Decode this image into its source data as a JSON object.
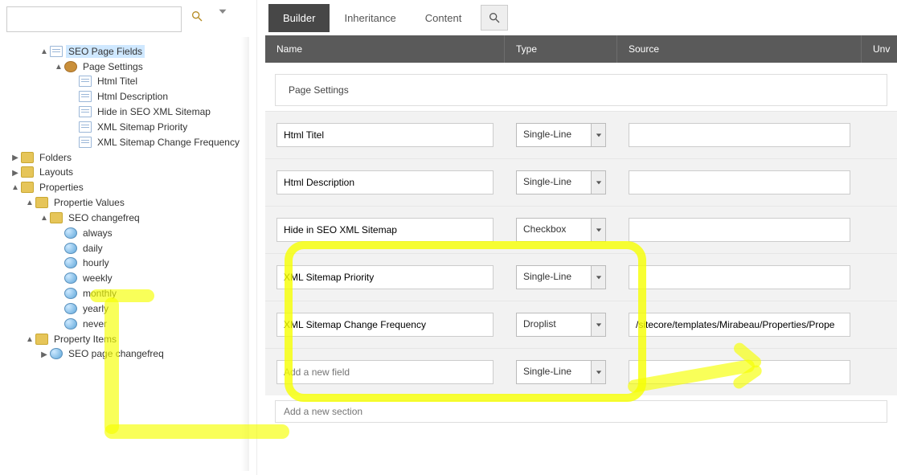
{
  "sidebar": {
    "search_placeholder": "",
    "tree": [
      {
        "indent": 2,
        "toggle": "▲",
        "icon": "page",
        "label": "SEO Page Fields",
        "selected": true
      },
      {
        "indent": 3,
        "toggle": "▲",
        "icon": "gear",
        "label": "Page Settings"
      },
      {
        "indent": 4,
        "toggle": "",
        "icon": "page",
        "label": "Html Titel"
      },
      {
        "indent": 4,
        "toggle": "",
        "icon": "page",
        "label": "Html Description"
      },
      {
        "indent": 4,
        "toggle": "",
        "icon": "page",
        "label": "Hide in SEO XML Sitemap"
      },
      {
        "indent": 4,
        "toggle": "",
        "icon": "page",
        "label": "XML Sitemap Priority"
      },
      {
        "indent": 4,
        "toggle": "",
        "icon": "page",
        "label": "XML Sitemap Change Frequency"
      },
      {
        "indent": 0,
        "toggle": "▶",
        "icon": "folder",
        "label": "Folders"
      },
      {
        "indent": 0,
        "toggle": "▶",
        "icon": "folder",
        "label": "Layouts"
      },
      {
        "indent": 0,
        "toggle": "▲",
        "icon": "folder",
        "label": "Properties"
      },
      {
        "indent": 1,
        "toggle": "▲",
        "icon": "folder",
        "label": "Propertie Values"
      },
      {
        "indent": 2,
        "toggle": "▲",
        "icon": "folder",
        "label": "SEO changefreq"
      },
      {
        "indent": 3,
        "toggle": "",
        "icon": "ball",
        "label": "always"
      },
      {
        "indent": 3,
        "toggle": "",
        "icon": "ball",
        "label": "daily"
      },
      {
        "indent": 3,
        "toggle": "",
        "icon": "ball",
        "label": "hourly"
      },
      {
        "indent": 3,
        "toggle": "",
        "icon": "ball",
        "label": "weekly"
      },
      {
        "indent": 3,
        "toggle": "",
        "icon": "ball",
        "label": "monthly"
      },
      {
        "indent": 3,
        "toggle": "",
        "icon": "ball",
        "label": "yearly"
      },
      {
        "indent": 3,
        "toggle": "",
        "icon": "ball",
        "label": "never"
      },
      {
        "indent": 1,
        "toggle": "▲",
        "icon": "folder",
        "label": "Property Items"
      },
      {
        "indent": 2,
        "toggle": "▶",
        "icon": "ball",
        "label": "SEO page changefreq"
      }
    ]
  },
  "content": {
    "tabs": {
      "builder": "Builder",
      "inheritance": "Inheritance",
      "content": "Content"
    },
    "headers": {
      "name": "Name",
      "type": "Type",
      "source": "Source",
      "unv": "Unv"
    },
    "section_title": "Page Settings",
    "rows": [
      {
        "name": "Html Titel",
        "type": "Single-Line",
        "source": ""
      },
      {
        "name": "Html Description",
        "type": "Single-Line",
        "source": ""
      },
      {
        "name": "Hide in SEO XML Sitemap",
        "type": "Checkbox",
        "source": ""
      },
      {
        "name": "XML Sitemap Priority",
        "type": "Single-Line",
        "source": ""
      },
      {
        "name": "XML Sitemap Change Frequency",
        "type": "Droplist",
        "source": "/sitecore/templates/Mirabeau/Properties/Prope"
      }
    ],
    "add_field_placeholder": "Add a new field",
    "add_field_type": "Single-Line",
    "add_section_placeholder": "Add a new section"
  }
}
